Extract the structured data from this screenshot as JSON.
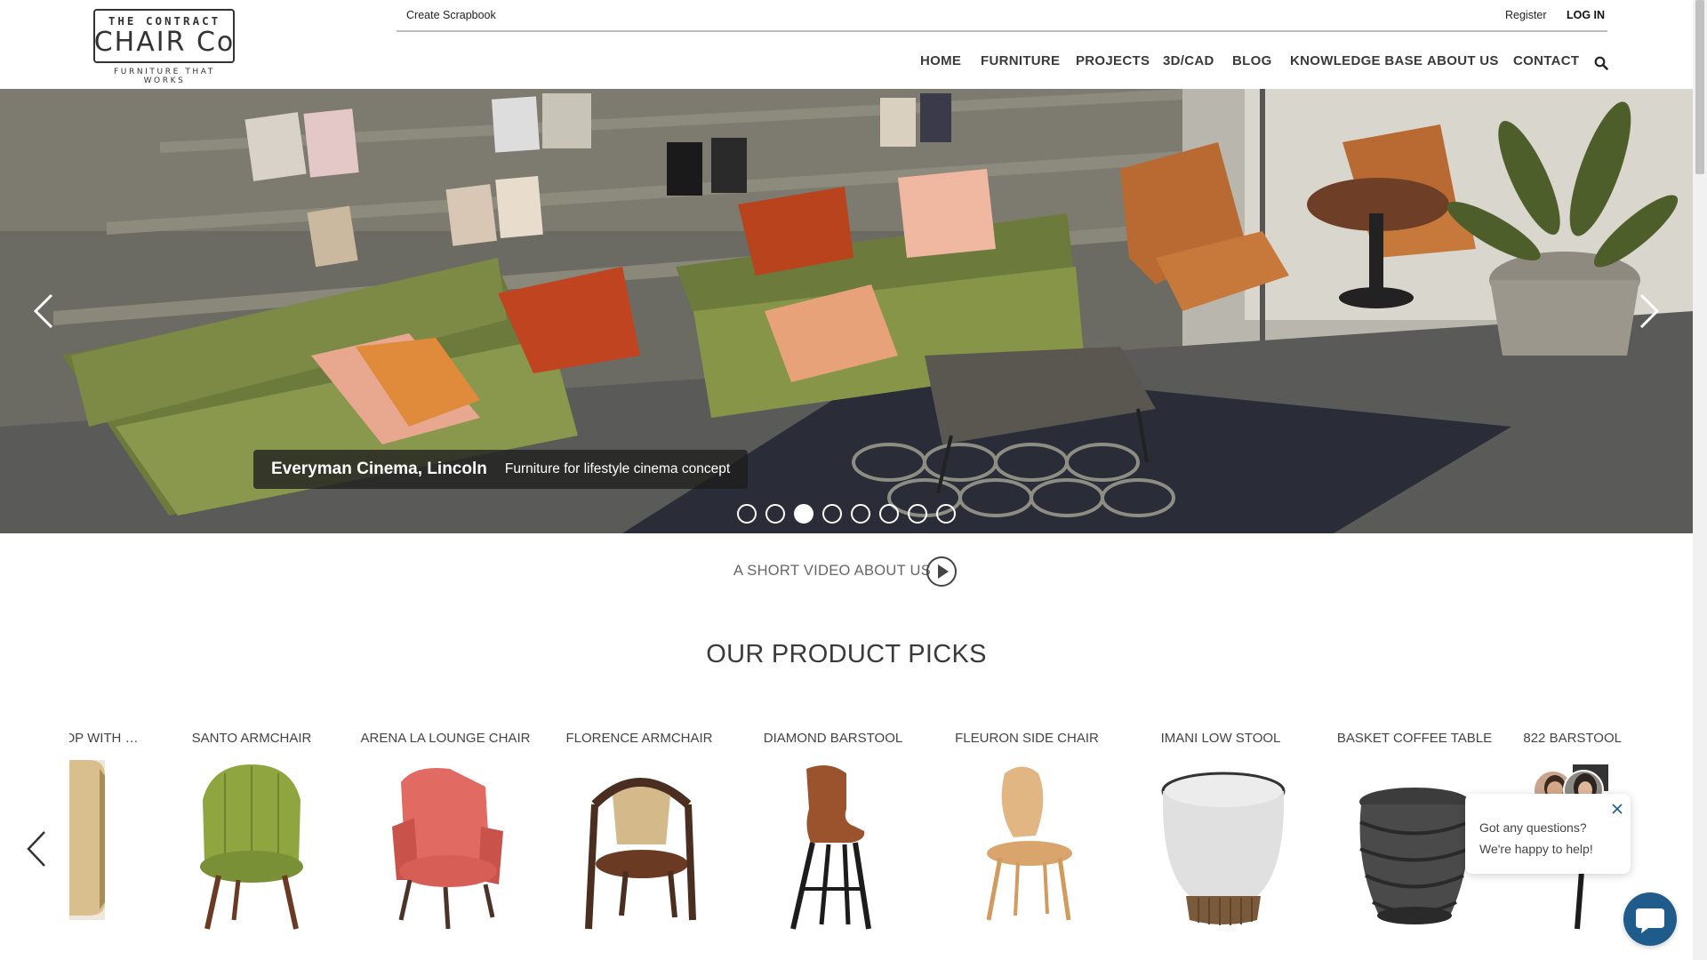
{
  "logo": {
    "line1": "THE CONTRACT",
    "line2": "CHAIR Co",
    "tagline": "FURNITURE THAT WORKS"
  },
  "topbar": {
    "create_scrapbook": "Create Scrapbook",
    "register": "Register",
    "login": "LOG IN"
  },
  "nav": {
    "items": [
      "HOME",
      "FURNITURE",
      "PROJECTS",
      "3D/CAD",
      "BLOG",
      "KNOWLEDGE BASE",
      "ABOUT US",
      "CONTACT"
    ],
    "search_icon": "search-icon"
  },
  "hero": {
    "caption_title": "Everyman Cinema, Lincoln",
    "caption_subtitle": "Furniture for lifestyle cinema concept",
    "slide_count": 8,
    "active_slide": 3
  },
  "video": {
    "label": "A SHORT VIDEO ABOUT US"
  },
  "picks": {
    "title": "OUR PRODUCT PICKS",
    "products": [
      "...OP WITH B...",
      "SANTO ARMCHAIR",
      "ARENA LA LOUNGE CHAIR",
      "FLORENCE ARMCHAIR",
      "DIAMOND BARSTOOL",
      "FLEURON SIDE CHAIR",
      "IMANI LOW STOOL",
      "BASKET COFFEE TABLE",
      "822 BARSTOOL"
    ]
  },
  "chat": {
    "message": "Got any questions? We're happy to help!"
  },
  "colors": {
    "chat_button": "#1f5c8c",
    "text_dark": "#333333"
  }
}
